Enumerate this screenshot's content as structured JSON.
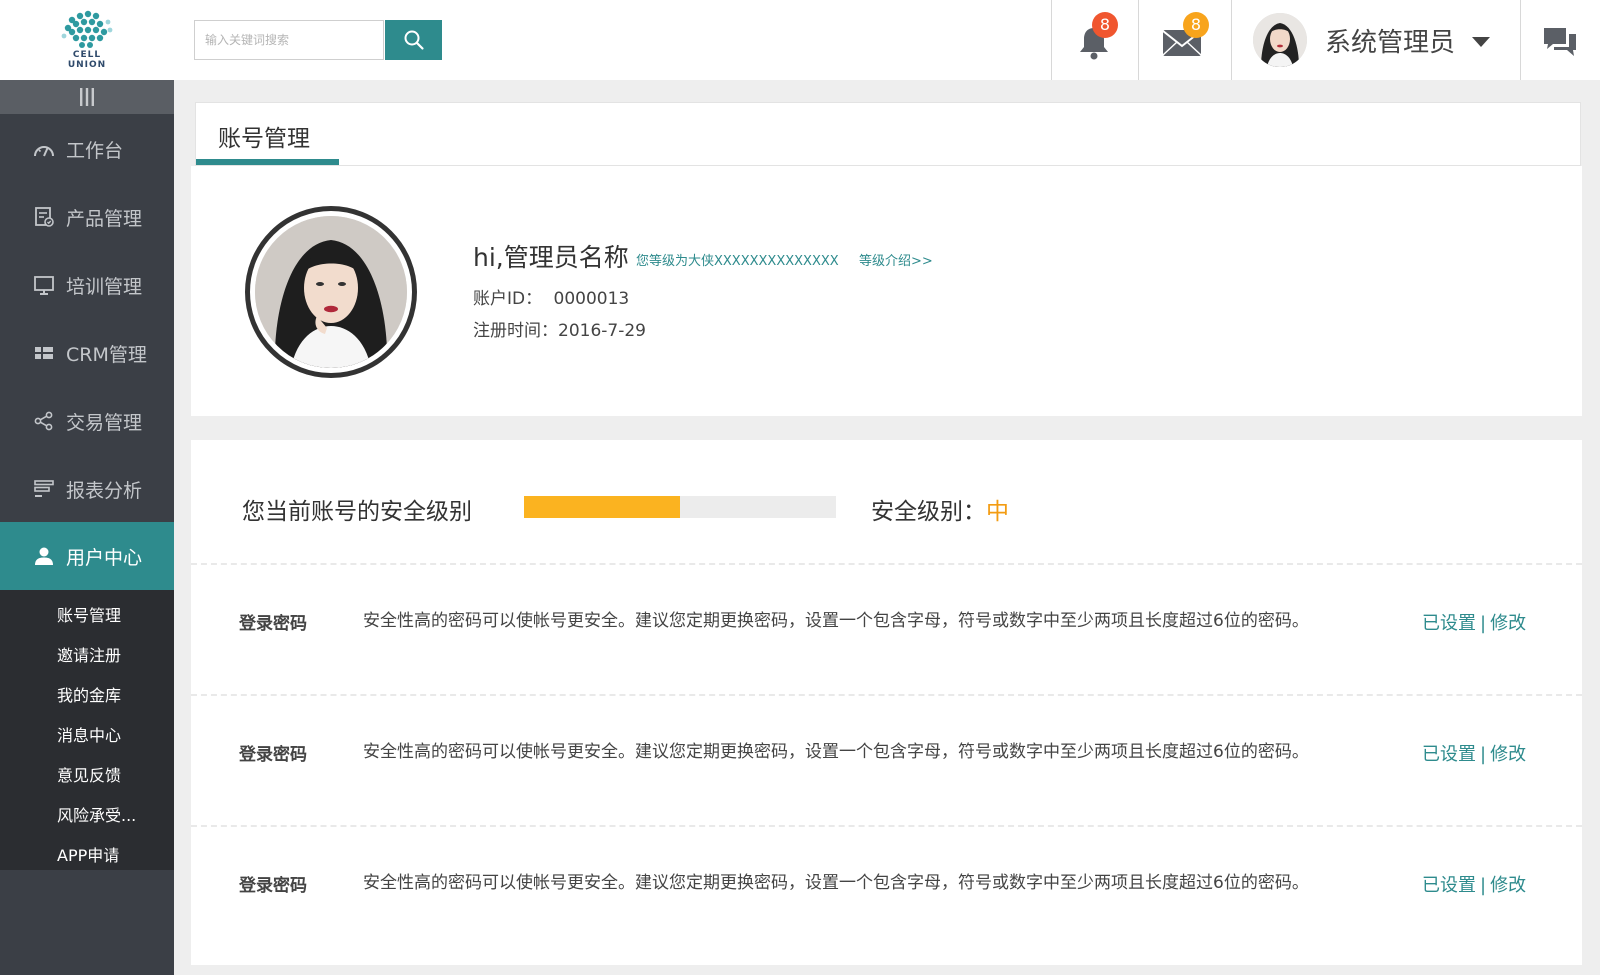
{
  "header": {
    "logo_text_line1": "CELL",
    "logo_text_line2": "UNION",
    "search_placeholder": "输入关键词搜索",
    "notifications_count": "8",
    "messages_count": "8",
    "user_name": "系统管理员"
  },
  "colors": {
    "accent": "#2e8b8d",
    "sidebar_bg": "#3b3f46",
    "submenu_bg": "#2b2d31",
    "badge_red": "#f0562f",
    "badge_orange": "#f8a41c",
    "progress": "#fbb320",
    "security_level": "#f39c12"
  },
  "icons": {
    "search": "search-icon",
    "bell": "bell-icon",
    "mail": "mail-icon",
    "chat": "chat-icon",
    "collapse": "menu-collapse-icon"
  },
  "sidebar": {
    "items": [
      {
        "label": "工作台",
        "icon": "dashboard-icon"
      },
      {
        "label": "产品管理",
        "icon": "product-icon"
      },
      {
        "label": "培训管理",
        "icon": "monitor-icon"
      },
      {
        "label": "CRM管理",
        "icon": "grid-icon"
      },
      {
        "label": "交易管理",
        "icon": "share-icon"
      },
      {
        "label": "报表分析",
        "icon": "report-icon"
      },
      {
        "label": "用户中心",
        "icon": "user-icon",
        "active": true
      }
    ],
    "submenu": [
      "账号管理",
      "邀请注册",
      "我的金库",
      "消息中心",
      "意见反馈",
      "风险承受...",
      "APP申请"
    ]
  },
  "page": {
    "tab_title": "账号管理"
  },
  "profile": {
    "greeting": "hi,管理员名称",
    "level_text": "您等级为大侠XXXXXXXXXXXXXX",
    "level_link": "等级介绍>>",
    "account_id_label": "账户ID：",
    "account_id_value": "0000013",
    "register_time": "注册时间：2016-7-29"
  },
  "security": {
    "title": "您当前账号的安全级别",
    "progress_fraction": 0.5,
    "level_label": "安全级别：",
    "level_value": "中",
    "rows": [
      {
        "label": "登录密码",
        "description": "安全性高的密码可以使帐号更安全。建议您定期更换密码，设置一个包含字母，符号或数字中至少两项且长度超过6位的密码。",
        "status": "已设置",
        "separator": "|",
        "action": "修改"
      },
      {
        "label": "登录密码",
        "description": "安全性高的密码可以使帐号更安全。建议您定期更换密码，设置一个包含字母，符号或数字中至少两项且长度超过6位的密码。",
        "status": "已设置",
        "separator": "|",
        "action": "修改"
      },
      {
        "label": "登录密码",
        "description": "安全性高的密码可以使帐号更安全。建议您定期更换密码，设置一个包含字母，符号或数字中至少两项且长度超过6位的密码。",
        "status": "已设置",
        "separator": "|",
        "action": "修改"
      }
    ]
  }
}
